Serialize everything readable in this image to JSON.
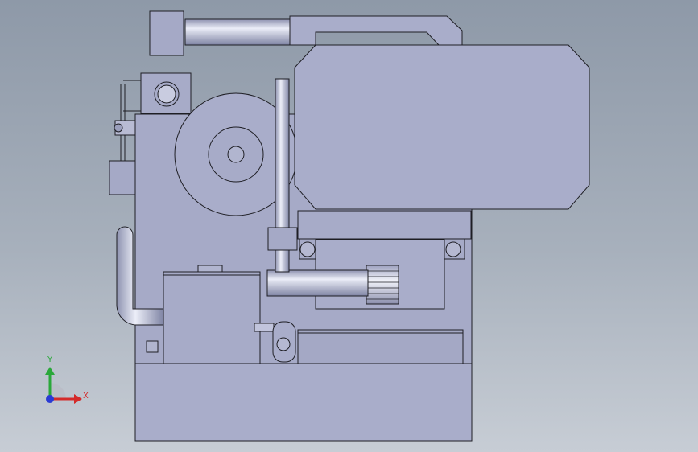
{
  "viewport": {
    "background_top": "#8e99a8",
    "background_bottom": "#c7cdd5",
    "part_fill": "#a9adca",
    "edge_color": "#1e1e24"
  },
  "triad": {
    "x_label": "X",
    "y_label": "Y",
    "x_color": "#d42a2a",
    "y_color": "#2aa83a",
    "z_color": "#2a3ad4"
  }
}
